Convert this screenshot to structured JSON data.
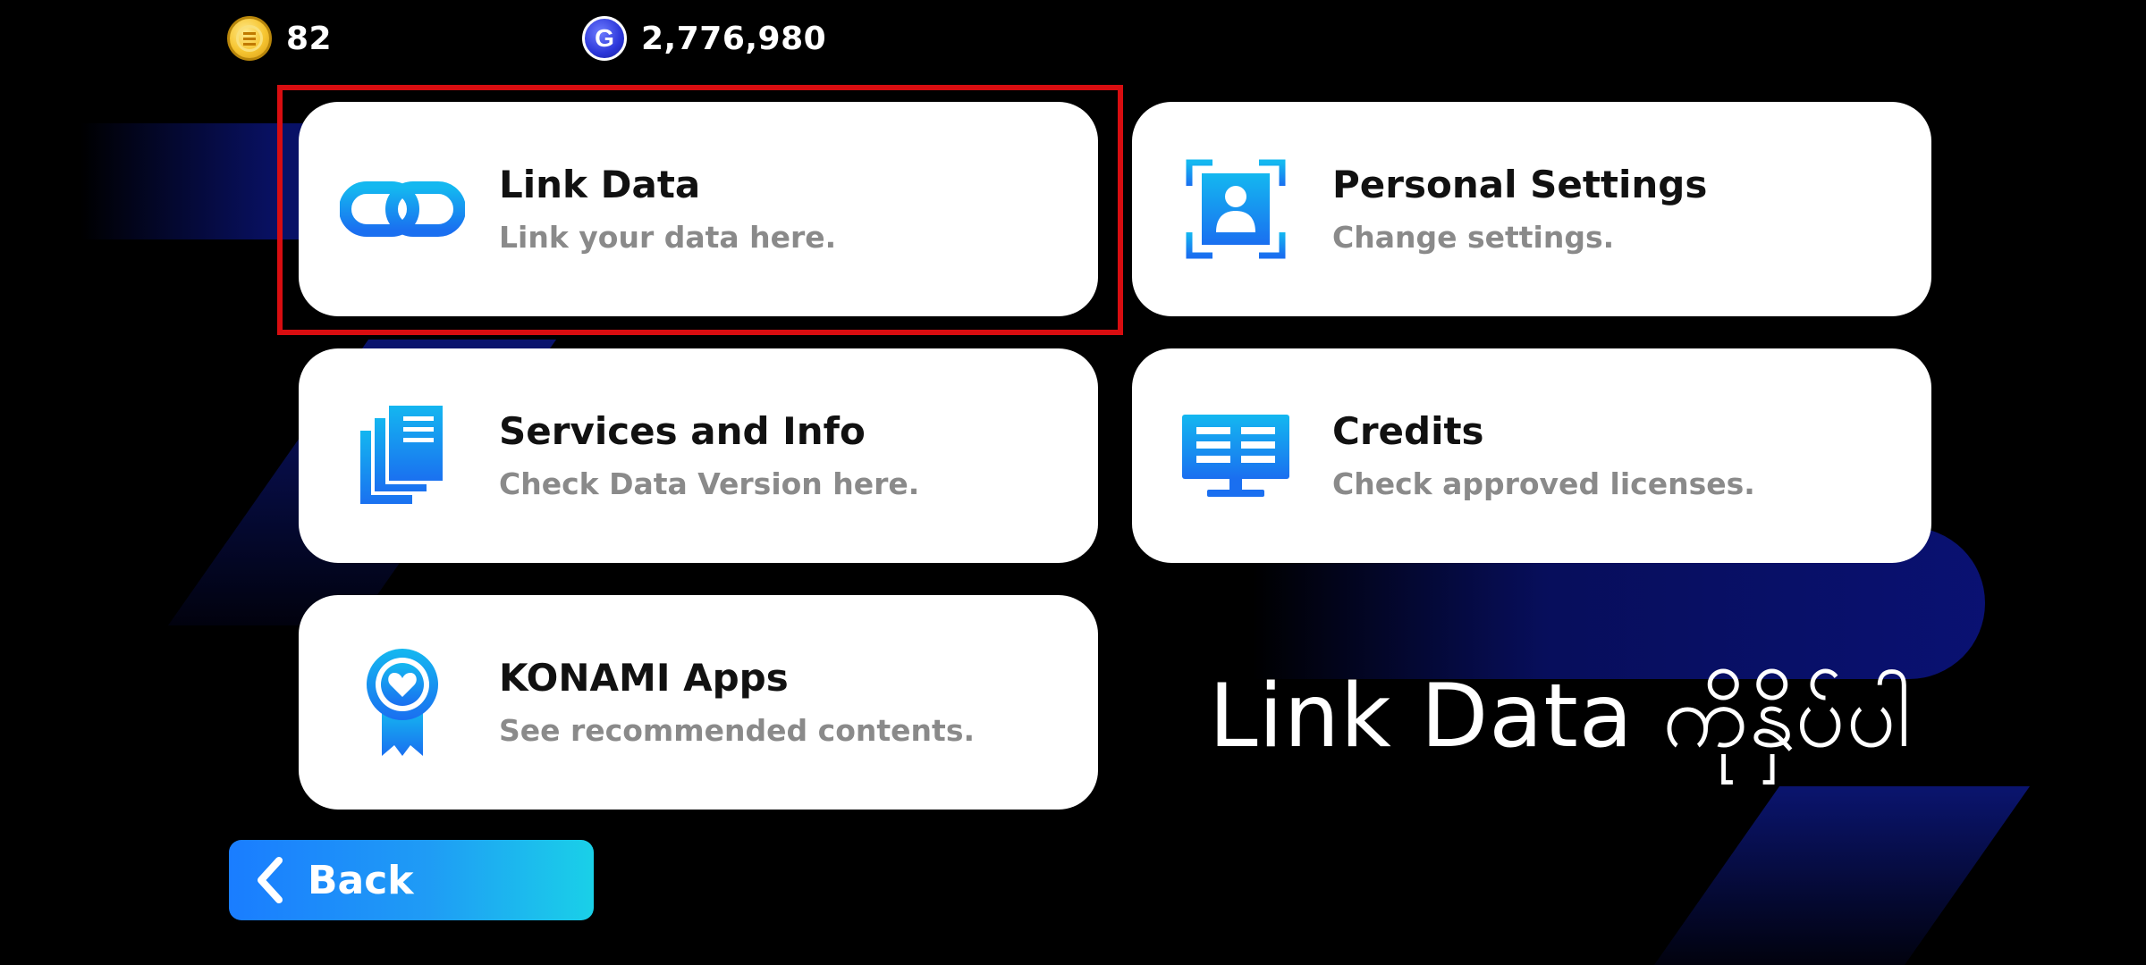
{
  "currency": {
    "coins_value": "82",
    "gp_value": "2,776,980",
    "gp_symbol": "G"
  },
  "cards": [
    {
      "id": "link-data",
      "title": "Link Data",
      "subtitle": "Link your data here.",
      "icon": "link-chain-icon"
    },
    {
      "id": "personal-settings",
      "title": "Personal Settings",
      "subtitle": "Change settings.",
      "icon": "profile-frame-icon"
    },
    {
      "id": "services-info",
      "title": "Services and Info",
      "subtitle": "Check Data Version here.",
      "icon": "documents-stack-icon"
    },
    {
      "id": "credits",
      "title": "Credits",
      "subtitle": "Check approved licenses.",
      "icon": "monitor-icon"
    },
    {
      "id": "konami-apps",
      "title": "KONAMI Apps",
      "subtitle": "See recommended contents.",
      "icon": "heart-ribbon-badge-icon"
    }
  ],
  "back": {
    "label": "Back",
    "icon": "chevron-left-icon"
  },
  "instruction": "Link Data ကိုနှိပ်ပါ",
  "colors": {
    "background": "#000000",
    "card_bg": "#ffffff",
    "highlight": "#d80d10",
    "accent_blue": "#1a7dff",
    "accent_cyan": "#1ad0e8",
    "icon_gradient_top": "#14b8f0",
    "icon_gradient_bottom": "#1a6ff0"
  }
}
